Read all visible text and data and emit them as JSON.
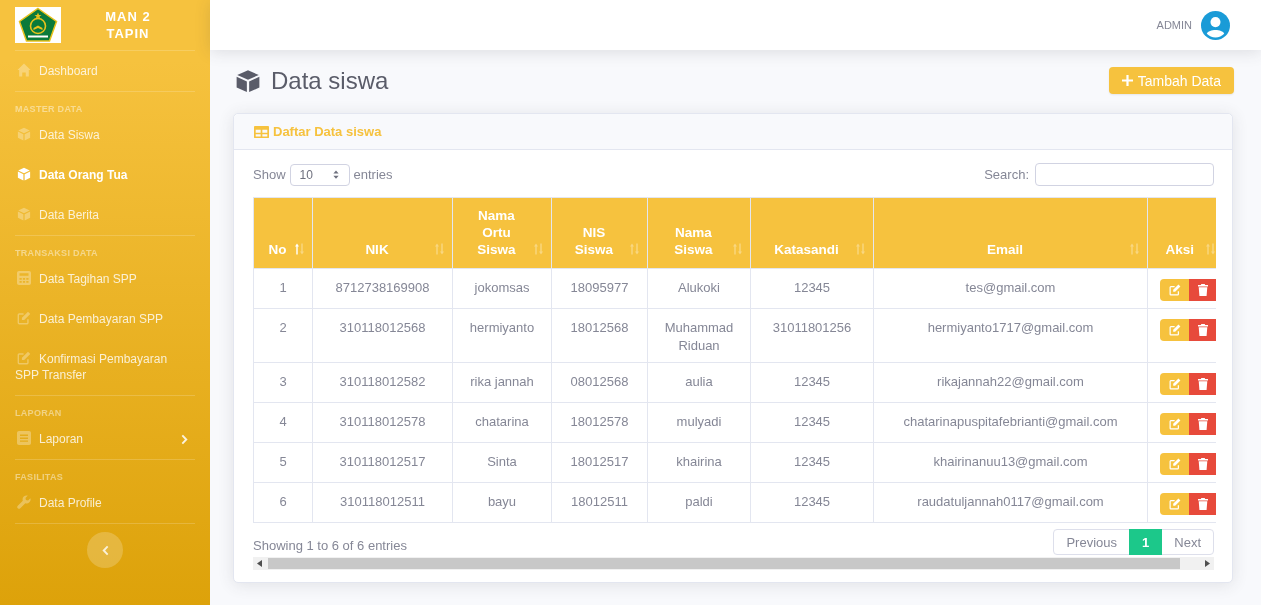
{
  "topbar": {
    "user": "ADMIN"
  },
  "sidebar": {
    "brand": "MAN 2 TAPIN",
    "sections": [
      {
        "items": [
          {
            "label": "Dashboard",
            "selected": false
          }
        ]
      },
      {
        "heading": "MASTER DATA",
        "items": [
          {
            "label": "Data Siswa",
            "selected": false
          },
          {
            "label": "Data Orang Tua",
            "selected": true
          },
          {
            "label": "Data Berita",
            "selected": false
          }
        ]
      },
      {
        "heading": "TRANSAKSI DATA",
        "items": [
          {
            "label": "Data Tagihan SPP",
            "selected": false
          },
          {
            "label": "Data Pembayaran SPP",
            "selected": false
          },
          {
            "label": "Konfirmasi Pembayaran SPP Transfer",
            "selected": false
          }
        ]
      },
      {
        "heading": "LAPORAN",
        "items": [
          {
            "label": "Laporan",
            "selected": false,
            "expanded": false
          }
        ]
      },
      {
        "heading": "FASILITAS",
        "items": [
          {
            "label": "Data Profile",
            "selected": false
          }
        ]
      }
    ]
  },
  "page": {
    "title": "Data siswa",
    "add_button": "Tambah Data"
  },
  "card": {
    "title": "Daftar Data siswa",
    "length_menu": {
      "before": "Show",
      "value": "10",
      "after": "entries"
    },
    "search": {
      "label": "Search:"
    },
    "table": {
      "columns": [
        {
          "label": "No",
          "kind": "text",
          "sorted": true
        },
        {
          "label": "NIK",
          "kind": "text",
          "sorted": false
        },
        {
          "label": "Nama Ortu Siswa",
          "kind": "text",
          "sorted": false
        },
        {
          "label": "NIS Siswa",
          "kind": "text",
          "sorted": false
        },
        {
          "label": "Nama Siswa",
          "kind": "text",
          "sorted": false
        },
        {
          "label": "Katasandi",
          "kind": "text",
          "sorted": false
        },
        {
          "label": "Email",
          "kind": "text",
          "sorted": false
        },
        {
          "label": "Aksi",
          "kind": "actions",
          "sorted": false
        }
      ],
      "rows": [
        [
          "1",
          "8712738169908",
          "jokomsas",
          "18095977",
          "Alukoki",
          "12345",
          "tes@gmail.com"
        ],
        [
          "2",
          "310118012568",
          "hermiyanto",
          "18012568",
          "Muhammad Riduan",
          "31011801256",
          "hermiyanto1717@gmail.com"
        ],
        [
          "3",
          "310118012582",
          "rika jannah",
          "08012568",
          "aulia",
          "12345",
          "rikajannah22@gmail.com"
        ],
        [
          "4",
          "310118012578",
          "chatarina",
          "18012578",
          "mulyadi",
          "12345",
          "chatarinapuspitafebrianti@gmail.com"
        ],
        [
          "5",
          "310118012517",
          "Sinta",
          "18012517",
          "khairina",
          "12345",
          "khairinanuu13@gmail.com"
        ],
        [
          "6",
          "310118012511",
          "bayu",
          "18012511",
          "paldi",
          "12345",
          "raudatuljannah0117@gmail.com"
        ]
      ]
    },
    "info": "Showing 1 to 6 of 6 entries",
    "pagination": [
      {
        "label": "Previous",
        "selected": false,
        "disabled": true
      },
      {
        "label": "1",
        "selected": true,
        "disabled": false
      },
      {
        "label": "Next",
        "selected": false,
        "disabled": true
      }
    ]
  }
}
